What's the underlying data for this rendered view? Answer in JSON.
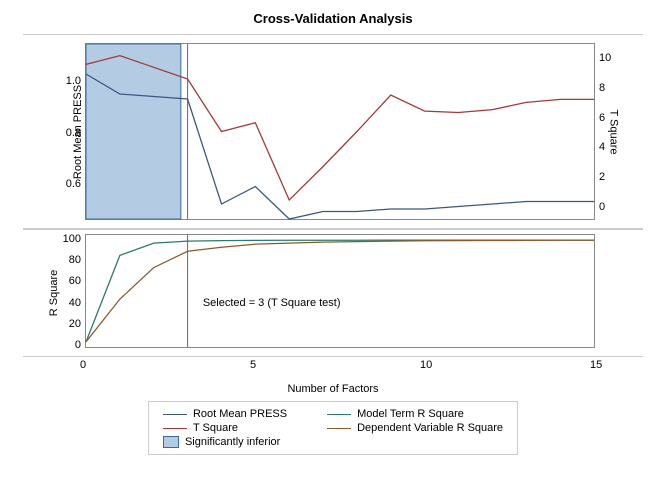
{
  "title": "Cross-Validation Analysis",
  "x_axis": {
    "label": "Number of Factors",
    "ticks": [
      0,
      5,
      10,
      15
    ]
  },
  "top_panel": {
    "y_left": {
      "label": "Root Mean PRESS",
      "ticks": [
        0.6,
        0.8,
        1.0
      ]
    },
    "y_right": {
      "label": "T Square",
      "ticks": [
        0,
        2,
        4,
        6,
        8,
        10
      ]
    }
  },
  "bottom_panel": {
    "y_left": {
      "label": "R Square",
      "ticks": [
        0,
        20,
        40,
        60,
        80,
        100
      ]
    },
    "annotation": "Selected = 3 (T Square test)"
  },
  "legend": {
    "items": [
      {
        "label": "Root Mean PRESS",
        "color": "#3b577f"
      },
      {
        "label": "Model Term R Square",
        "color": "#2a7a6e"
      },
      {
        "label": "T Square",
        "color": "#a03a3a"
      },
      {
        "label": "Dependent Variable R Square",
        "color": "#8b5a2b"
      },
      {
        "label": "Significantly inferior",
        "kind": "box"
      }
    ]
  },
  "chart_data": [
    {
      "type": "line",
      "title": "Cross-Validation Analysis",
      "xlabel": "Number of Factors",
      "x": [
        0,
        1,
        2,
        3,
        4,
        5,
        6,
        7,
        8,
        9,
        10,
        11,
        12,
        13,
        14,
        15
      ],
      "series": [
        {
          "name": "Root Mean PRESS",
          "axis": "left",
          "color": "#3b577f",
          "values": [
            1.03,
            0.95,
            0.94,
            0.93,
            0.51,
            0.58,
            0.45,
            0.48,
            0.48,
            0.49,
            0.49,
            0.5,
            0.51,
            0.52,
            0.52,
            0.52
          ]
        },
        {
          "name": "T Square",
          "axis": "right",
          "color": "#a03a3a",
          "values": [
            9.6,
            10.2,
            9.4,
            8.6,
            5.0,
            5.6,
            0.3,
            2.6,
            5.0,
            7.5,
            6.4,
            6.3,
            6.5,
            7.0,
            7.2,
            7.2
          ]
        }
      ],
      "ylim_left": [
        0.45,
        1.15
      ],
      "ylim_right": [
        -1,
        11
      ],
      "shaded_region": {
        "xmin": 0,
        "xmax": 2.8
      },
      "vline": 3
    },
    {
      "type": "line",
      "xlabel": "Number of Factors",
      "ylabel": "R Square",
      "x": [
        0,
        1,
        2,
        3,
        4,
        5,
        6,
        7,
        8,
        9,
        10,
        11,
        12,
        13,
        14,
        15
      ],
      "series": [
        {
          "name": "Model Term R Square",
          "color": "#2a7a6e",
          "values": [
            0,
            85,
            97,
            99,
            99.5,
            99.7,
            99.8,
            99.85,
            99.9,
            99.93,
            99.95,
            99.97,
            99.98,
            99.99,
            100,
            100
          ]
        },
        {
          "name": "Dependent Variable R Square",
          "color": "#8b5a2b",
          "values": [
            0,
            42,
            73,
            89,
            93,
            96,
            97,
            98,
            98.5,
            99,
            99.3,
            99.5,
            99.6,
            99.7,
            99.8,
            99.8
          ]
        }
      ],
      "ylim": [
        -5,
        105
      ],
      "annotation": "Selected = 3 (T Square test)",
      "vline": 3
    }
  ]
}
